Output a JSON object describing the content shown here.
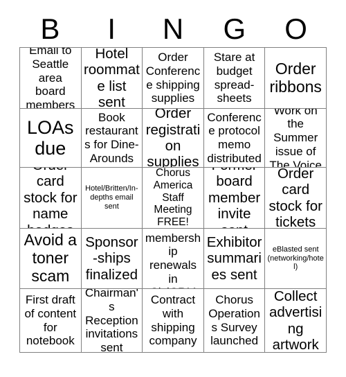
{
  "card": {
    "header_letters": [
      "B",
      "I",
      "N",
      "G",
      "O"
    ],
    "columns": 5,
    "rows": 5,
    "border_color": "#808080",
    "text_color": "#000000",
    "background_color": "#ffffff",
    "cells": [
      [
        {
          "text": "Email to Seattle area board members",
          "size": "md"
        },
        {
          "text": "Hotel roommate list sent",
          "size": "lg"
        },
        {
          "text": "Order Conference shipping supplies",
          "size": "md"
        },
        {
          "text": "Stare at budget spread-sheets",
          "size": "md"
        },
        {
          "text": "Order ribbons",
          "size": "xl"
        }
      ],
      [
        {
          "text": "LOAs due",
          "size": "xxl"
        },
        {
          "text": "Book restaurants for Dine-Arounds",
          "size": "md"
        },
        {
          "text": "Order registration supplies",
          "size": "lg"
        },
        {
          "text": "Conference protocol memo distributed",
          "size": "md"
        },
        {
          "text": "Work on the Summer issue of The Voice",
          "size": "md"
        }
      ],
      [
        {
          "text": "Order card stock for name badges",
          "size": "lg"
        },
        {
          "text": "Hotel/Britten/In-depths email sent",
          "size": "xs"
        },
        {
          "text": "Chorus America Staff Meeting FREE!",
          "size": "sm"
        },
        {
          "text": "Former board member invite sent",
          "size": "lg"
        },
        {
          "text": "Order card stock for tickets",
          "size": "lg"
        }
      ],
      [
        {
          "text": "Avoid a toner scam",
          "size": "xl"
        },
        {
          "text": "Sponsor-ships finalized",
          "size": "lg"
        },
        {
          "text": "Enter membership renewals in CiviCRM",
          "size": "md"
        },
        {
          "text": "Exhibitor summaries sent",
          "size": "lg"
        },
        {
          "text": "eBlasted sent (networking/hotel)",
          "size": "xs"
        }
      ],
      [
        {
          "text": "First draft of content for notebook",
          "size": "md"
        },
        {
          "text": "Chairman's Reception invitations sent",
          "size": "md"
        },
        {
          "text": "Contract with shipping company",
          "size": "md"
        },
        {
          "text": "Chorus Operations Survey launched",
          "size": "md"
        },
        {
          "text": "Collect advertising artwork",
          "size": "lg"
        }
      ]
    ]
  }
}
